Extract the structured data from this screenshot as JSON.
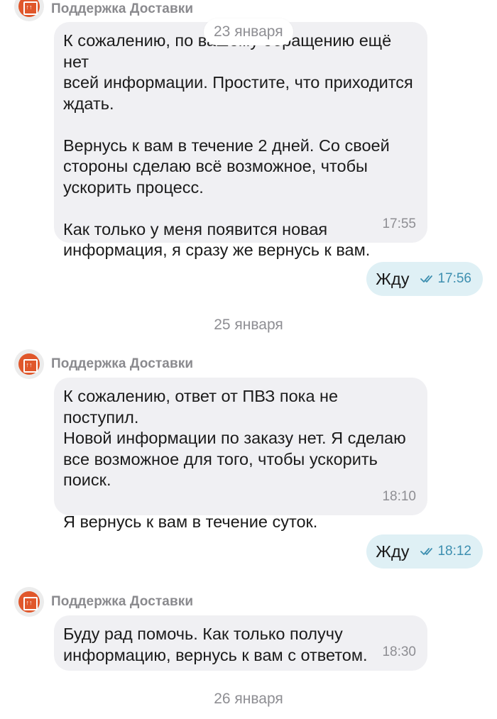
{
  "messages": [
    {
      "sender": "Поддержка Доставки",
      "paragraphs": [
        "К сожалению, по вашему обращению ещё нет\nвсей информации. Простите, что приходится\nждать.",
        "Вернусь к вам в течение 2 дней. Со своей\nстороны сделаю всё возможное, чтобы\nускорить процесс.",
        "Как только у меня появится новая\nинформация, я сразу же вернусь к вам."
      ],
      "time": "17:55"
    },
    {
      "text": "Жду",
      "time": "17:56"
    },
    {
      "sender": "Поддержка Доставки",
      "paragraphs": [
        "К сожалению, ответ от ПВЗ пока не поступил.\nНовой информации по заказу нет. Я сделаю\nвсе возможное для того, чтобы ускорить\nпоиск.",
        "Я вернусь к вам в течение суток."
      ],
      "time": "18:10"
    },
    {
      "text": "Жду",
      "time": "18:12"
    },
    {
      "sender": "Поддержка Доставки",
      "paragraphs": [
        "Буду рад помочь. Как только получу\nинформацию, вернусь к вам с ответом."
      ],
      "time": "18:30"
    }
  ],
  "dates": {
    "floating": "23 января",
    "sep1": "25 января",
    "sep2": "26 января"
  },
  "avatar_glyph": "↑↑",
  "colors": {
    "incoming_bubble": "#f0f0f3",
    "outgoing_bubble": "#dff0f5",
    "read_check": "#3d8fb0",
    "avatar_accent": "#e0572b"
  },
  "icons": [
    "support-avatar",
    "double-check-icon"
  ]
}
